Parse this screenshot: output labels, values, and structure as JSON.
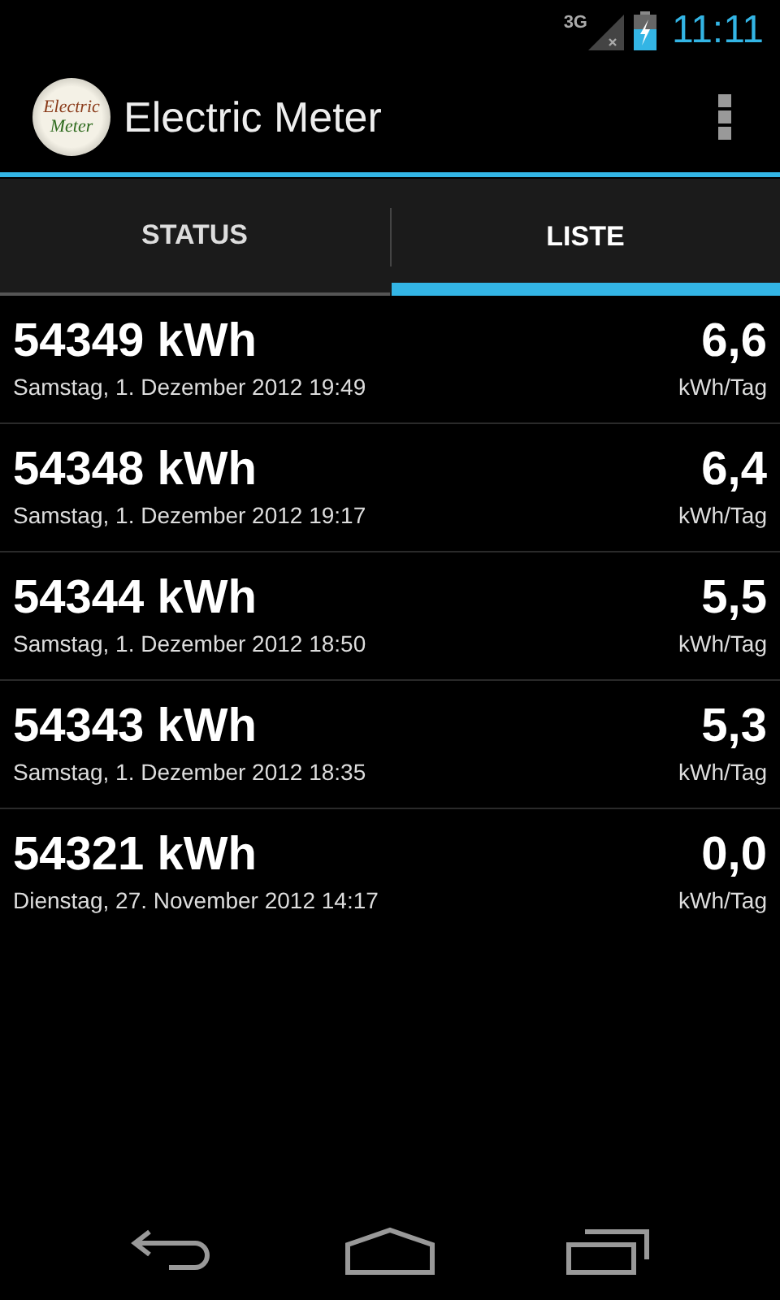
{
  "status_bar": {
    "network": "3G",
    "time": "11:11"
  },
  "app_bar": {
    "logo_lines": [
      "Electric",
      "Meter"
    ],
    "title": "Electric Meter"
  },
  "tabs": [
    {
      "label": "STATUS",
      "selected": false
    },
    {
      "label": "LISTE",
      "selected": true
    }
  ],
  "readings": [
    {
      "value": "54349 kWh",
      "date": "Samstag, 1. Dezember 2012 19:49",
      "rate": "6,6",
      "unit": "kWh/Tag"
    },
    {
      "value": "54348 kWh",
      "date": "Samstag, 1. Dezember 2012 19:17",
      "rate": "6,4",
      "unit": "kWh/Tag"
    },
    {
      "value": "54344 kWh",
      "date": "Samstag, 1. Dezember 2012 18:50",
      "rate": "5,5",
      "unit": "kWh/Tag"
    },
    {
      "value": "54343 kWh",
      "date": "Samstag, 1. Dezember 2012 18:35",
      "rate": "5,3",
      "unit": "kWh/Tag"
    },
    {
      "value": "54321 kWh",
      "date": "Dienstag, 27. November 2012 14:17",
      "rate": "0,0",
      "unit": "kWh/Tag"
    }
  ]
}
